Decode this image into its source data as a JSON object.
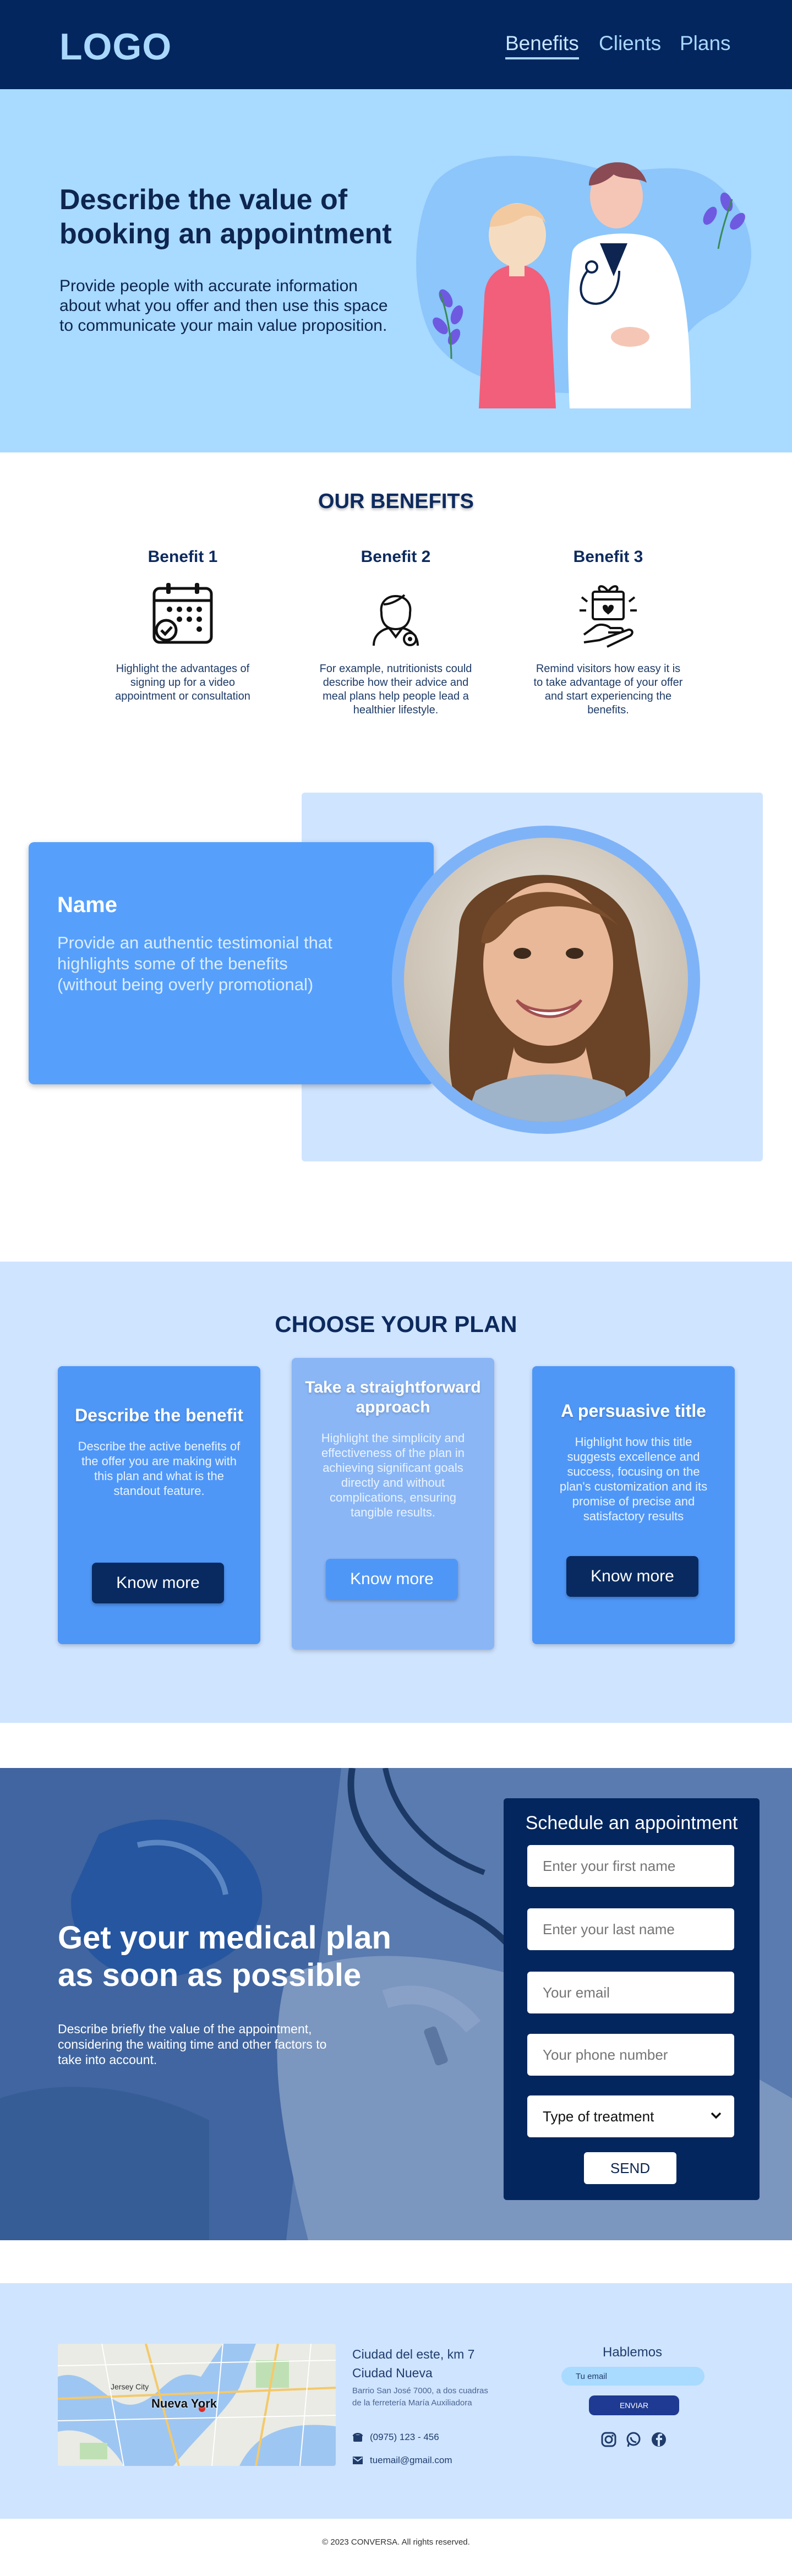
{
  "nav": {
    "logo": "LOGO",
    "links": [
      "Benefits",
      "Clients",
      "Plans"
    ]
  },
  "hero": {
    "title": "Describe the value of booking an appointment",
    "text": "Provide people with accurate information about what you offer and then use this space to communicate your main value proposition."
  },
  "benefits": {
    "title": "OUR BENEFITS",
    "items": [
      {
        "title": "Benefit 1",
        "text": "Highlight the advantages of signing up for a video appointment or consultation",
        "icon": "calendar-check-icon"
      },
      {
        "title": "Benefit 2",
        "text": "For example, nutritionists could describe how their advice and meal plans help people lead a healthier lifestyle.",
        "icon": "nurse-icon"
      },
      {
        "title": "Benefit 3",
        "text": "Remind visitors how easy it is to take advantage of your offer and start experiencing the benefits.",
        "icon": "gift-hand-icon"
      }
    ]
  },
  "testimonial": {
    "name": "Name",
    "text": "Provide an authentic testimonial that highlights some of the benefits (without being overly promotional)"
  },
  "plans": {
    "title": "CHOOSE YOUR PLAN",
    "cards": [
      {
        "title": "Describe the benefit",
        "text": "Describe the active benefits of the offer you are making with this plan and what is the standout feature.",
        "button": "Know more"
      },
      {
        "title": "Take a straightforward approach",
        "text": "Highlight the simplicity and effectiveness of the plan in achieving significant goals directly and without complications, ensuring tangible results.",
        "button": "Know more"
      },
      {
        "title": "A persuasive title",
        "text": "Highlight how this title suggests excellence and success, focusing on the plan's customization and its promise of precise and satisfactory results",
        "button": "Know more"
      }
    ]
  },
  "appointment": {
    "title": "Get your medical plan as soon as possible",
    "text": "Describe briefly the value of the appointment, considering the waiting time and other factors to take into account.",
    "form": {
      "title": "Schedule an appointment",
      "first_name_placeholder": "Enter your first name",
      "last_name_placeholder": "Enter your last name",
      "email_placeholder": "Your email",
      "phone_placeholder": "Your phone number",
      "treatment_label": "Type of treatment",
      "send": "SEND"
    }
  },
  "footer": {
    "map_label": "Nueva York",
    "map_places": [
      "Jersey City"
    ],
    "address_line1": "Ciudad del este, km 7",
    "address_line2": "Ciudad Nueva",
    "address_detail": "Barrio San José 7000, a dos cuadras de la ferretería María Auxiliadora",
    "phone": "(0975) 123 - 456",
    "email": "tuemail@gmail.com",
    "talk_title": "Hablemos",
    "email_input_value": "Tu email",
    "send_button": "ENVIAR",
    "social_icons": [
      "instagram-icon",
      "whatsapp-icon",
      "facebook-icon"
    ],
    "copyright": "© 2023 CONVERSA. All rights reserved."
  },
  "colors": {
    "navy": "#03265e",
    "light_blue": "#a9daff",
    "pale_blue": "#cfe4ff",
    "accent_blue": "#4f97f7"
  }
}
